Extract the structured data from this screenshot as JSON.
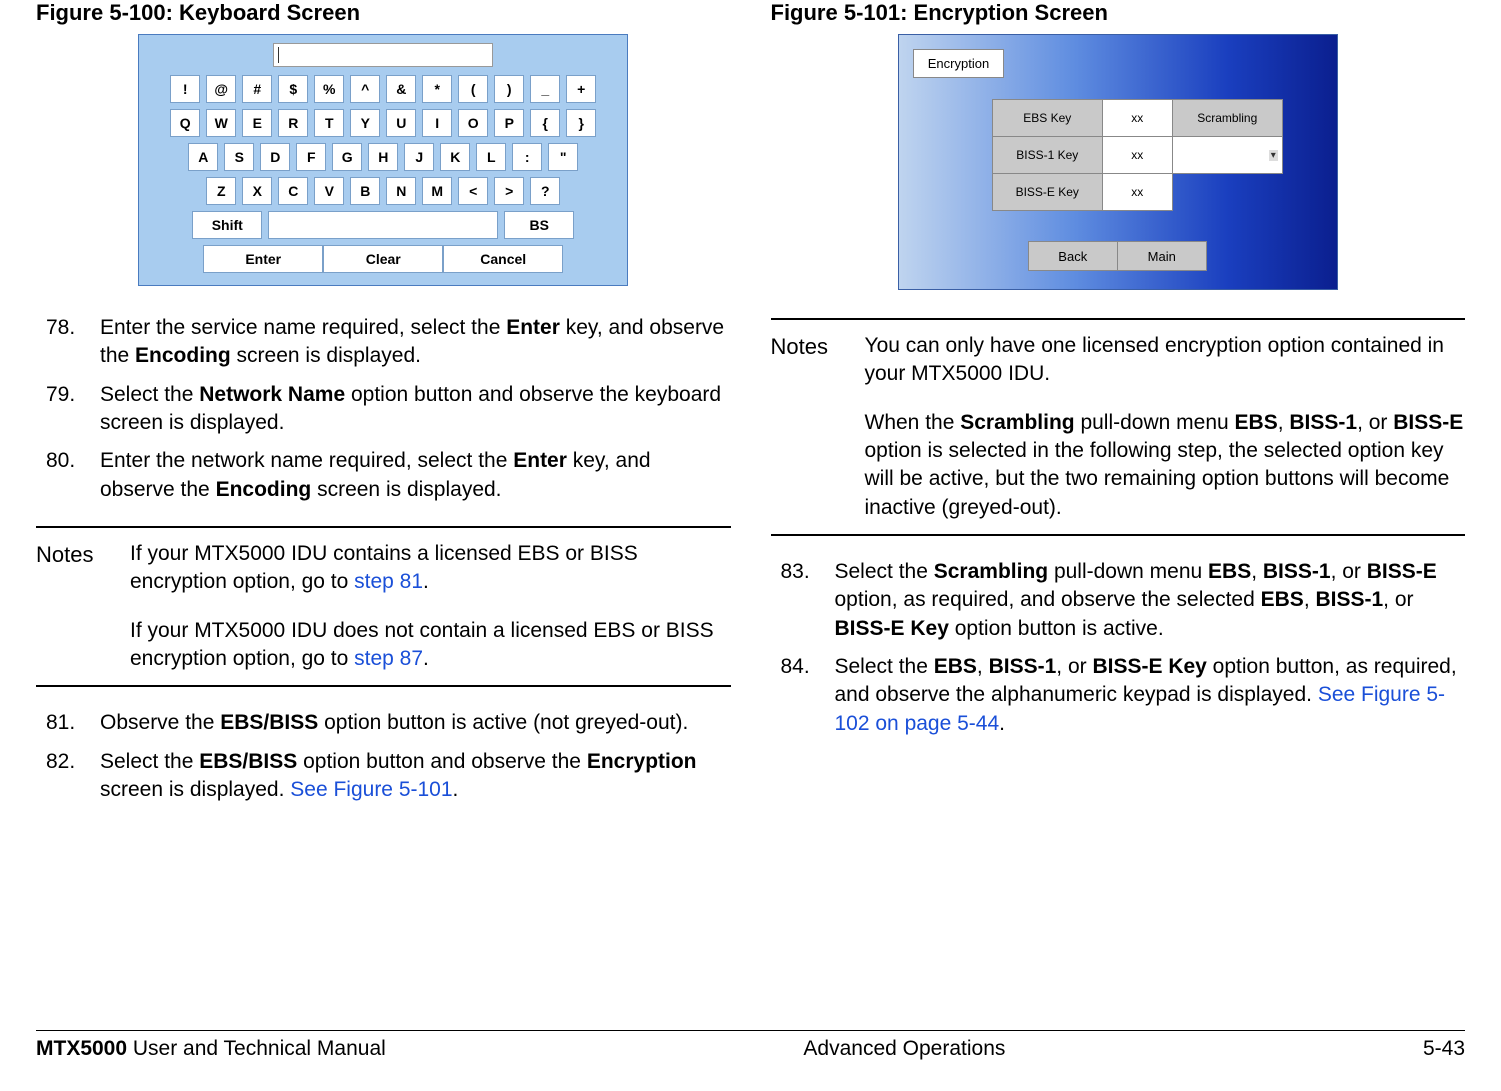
{
  "left": {
    "fig_title": "Figure 5-100:   Keyboard Screen",
    "keys": {
      "row1": [
        "!",
        "@",
        "#",
        "$",
        "%",
        "^",
        "&",
        "*",
        "(",
        ")",
        "_",
        "+"
      ],
      "row2": [
        "Q",
        "W",
        "E",
        "R",
        "T",
        "Y",
        "U",
        "I",
        "O",
        "P",
        "{",
        "}"
      ],
      "row3": [
        "A",
        "S",
        "D",
        "F",
        "G",
        "H",
        "J",
        "K",
        "L",
        ":",
        "\""
      ],
      "row4": [
        "Z",
        "X",
        "C",
        "V",
        "B",
        "N",
        "M",
        "<",
        ">",
        "?"
      ],
      "shift": "Shift",
      "bs": "BS",
      "enter": "Enter",
      "clear": "Clear",
      "cancel": "Cancel"
    },
    "steps_a": [
      {
        "n": "78.",
        "html": "Enter the service name required, select the <b>Enter</b> key, and observe the <b>Encoding</b> screen is displayed."
      },
      {
        "n": "79.",
        "html": "Select the <b>Network Name</b> option button and observe the keyboard screen is displayed."
      },
      {
        "n": "80.",
        "html": "Enter the network name required, select the <b>Enter</b> key, and observe the <b>Encoding</b> screen is displayed."
      }
    ],
    "notes_label": "Notes",
    "notes": [
      "If your MTX5000 IDU contains a licensed EBS or BISS encryption option, go to <span class=\"link\">step 81</span>.",
      "If your MTX5000 IDU does not contain a licensed EBS or BISS encryption option, go to <span class=\"link\">step 87</span>."
    ],
    "steps_b": [
      {
        "n": "81.",
        "html": "Observe the <b>EBS/BISS</b> option button is active (not greyed-out)."
      },
      {
        "n": "82.",
        "html": "Select the <b>EBS/BISS</b> option button and observe the <b>Encryption</b> screen is displayed.  <span class=\"link\">See Figure 5-101</span>."
      }
    ]
  },
  "right": {
    "fig_title": "Figure 5-101:   Encryption Screen",
    "enc_tab": "Encryption",
    "enc_rows": {
      "ebs": {
        "label": "EBS Key",
        "val": "xx",
        "scr": "Scrambling"
      },
      "biss1": {
        "label": "BISS-1 Key",
        "val": "xx"
      },
      "bisse": {
        "label": "BISS-E Key",
        "val": "xx"
      },
      "back": "Back",
      "main": "Main"
    },
    "notes_label": "Notes",
    "notes": [
      "You can only have one licensed encryption option contained in your MTX5000 IDU.",
      "When the <b>Scrambling</b> pull-down menu <b>EBS</b>, <b>BISS-1</b>, or <b>BISS-E</b> option is selected in the following step, the selected option key will be active, but the two remaining option buttons will become inactive (greyed-out)."
    ],
    "steps": [
      {
        "n": "83.",
        "html": "Select the <b>Scrambling</b> pull-down menu <b>EBS</b>, <b>BISS-1</b>, or <b>BISS-E</b> option, as required, and observe the selected <b>EBS</b>, <b>BISS-1</b>, or <b>BISS-E Key</b> option button is active."
      },
      {
        "n": "84.",
        "html": "Select the <b>EBS</b>, <b>BISS-1</b>, or <b>BISS-E Key</b> option button, as required, and observe the alphanumeric keypad is displayed.  <span class=\"link\">See Figure 5-102 on page 5-44</span>."
      }
    ]
  },
  "footer": {
    "left_bold": "MTX5000",
    "left_rest": " User and Technical Manual",
    "center": "Advanced Operations",
    "right": "5-43"
  }
}
